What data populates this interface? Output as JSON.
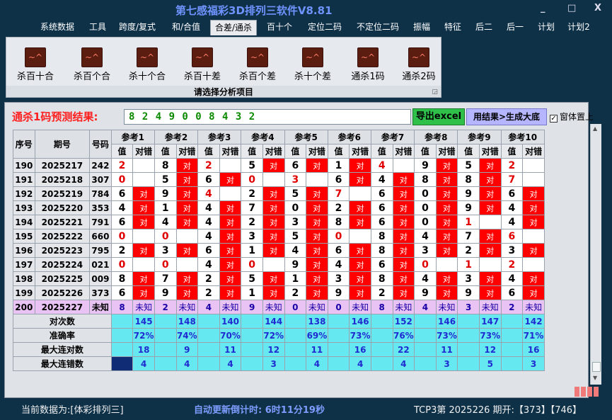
{
  "app": {
    "title": "第七感福彩3D排列三软件V8.81"
  },
  "window_controls": [
    "_",
    "□",
    "X"
  ],
  "menu": [
    "系统数据",
    "工具",
    "跨度/复式",
    "和/合值",
    "合差/通杀",
    "百十个",
    "定位二码",
    "不定位二码",
    "振幅",
    "特征",
    "后二",
    "后一",
    "计划",
    "计划2"
  ],
  "menu_active": 4,
  "ribbon": {
    "buttons": [
      "杀百十合",
      "杀百个合",
      "杀十个合",
      "杀百十差",
      "杀百个差",
      "杀十个差",
      "通杀1码",
      "通杀2码"
    ],
    "caption": "请选择分析项目"
  },
  "predict": {
    "label": "通杀1码预测结果:",
    "value": "8 2 4 9 0 0 8 4 3 2",
    "btn_excel": "导出excel",
    "btn_big": "用结果>生成大底",
    "checkbox_label": "窗体置上",
    "checkbox_checked": true
  },
  "table": {
    "head": {
      "no": "序号",
      "period": "期号",
      "code": "号码",
      "val": "值",
      "mark": "对错"
    },
    "groups": [
      "参考1",
      "参考2",
      "参考3",
      "参考4",
      "参考5",
      "参考6",
      "参考7",
      "参考8",
      "参考9",
      "参考10"
    ],
    "rows": [
      {
        "no": "190",
        "period": "2025217",
        "code": "242",
        "cells": [
          [
            "2",
            ""
          ],
          [
            "8",
            "对"
          ],
          [
            "2",
            ""
          ],
          [
            "5",
            "对"
          ],
          [
            "6",
            "对"
          ],
          [
            "1",
            "对"
          ],
          [
            "4",
            ""
          ],
          [
            "9",
            "对"
          ],
          [
            "5",
            "对"
          ],
          [
            "2",
            ""
          ]
        ]
      },
      {
        "no": "191",
        "period": "2025218",
        "code": "307",
        "cells": [
          [
            "0",
            ""
          ],
          [
            "5",
            "对"
          ],
          [
            "6",
            "对"
          ],
          [
            "0",
            ""
          ],
          [
            "3",
            ""
          ],
          [
            "6",
            "对"
          ],
          [
            "4",
            "对"
          ],
          [
            "8",
            "对"
          ],
          [
            "8",
            "对"
          ],
          [
            "7",
            ""
          ]
        ]
      },
      {
        "no": "192",
        "period": "2025219",
        "code": "784",
        "cells": [
          [
            "6",
            "对"
          ],
          [
            "9",
            "对"
          ],
          [
            "4",
            ""
          ],
          [
            "2",
            "对"
          ],
          [
            "5",
            "对"
          ],
          [
            "7",
            ""
          ],
          [
            "6",
            "对"
          ],
          [
            "0",
            "对"
          ],
          [
            "9",
            "对"
          ],
          [
            "6",
            "对"
          ]
        ]
      },
      {
        "no": "193",
        "period": "2025220",
        "code": "353",
        "cells": [
          [
            "4",
            "对"
          ],
          [
            "1",
            "对"
          ],
          [
            "4",
            "对"
          ],
          [
            "7",
            "对"
          ],
          [
            "0",
            "对"
          ],
          [
            "2",
            "对"
          ],
          [
            "6",
            "对"
          ],
          [
            "0",
            "对"
          ],
          [
            "9",
            "对"
          ],
          [
            "4",
            "对"
          ]
        ]
      },
      {
        "no": "194",
        "period": "2025221",
        "code": "791",
        "cells": [
          [
            "6",
            "对"
          ],
          [
            "4",
            "对"
          ],
          [
            "4",
            "对"
          ],
          [
            "2",
            "对"
          ],
          [
            "3",
            "对"
          ],
          [
            "8",
            "对"
          ],
          [
            "6",
            "对"
          ],
          [
            "0",
            "对"
          ],
          [
            "1",
            ""
          ],
          [
            "4",
            "对"
          ]
        ]
      },
      {
        "no": "195",
        "period": "2025222",
        "code": "660",
        "cells": [
          [
            "0",
            ""
          ],
          [
            "0",
            ""
          ],
          [
            "4",
            "对"
          ],
          [
            "3",
            "对"
          ],
          [
            "5",
            "对"
          ],
          [
            "0",
            ""
          ],
          [
            "8",
            "对"
          ],
          [
            "4",
            "对"
          ],
          [
            "7",
            "对"
          ],
          [
            "6",
            ""
          ]
        ]
      },
      {
        "no": "196",
        "period": "2025223",
        "code": "795",
        "cells": [
          [
            "2",
            "对"
          ],
          [
            "3",
            "对"
          ],
          [
            "6",
            "对"
          ],
          [
            "1",
            "对"
          ],
          [
            "4",
            "对"
          ],
          [
            "6",
            "对"
          ],
          [
            "8",
            "对"
          ],
          [
            "3",
            "对"
          ],
          [
            "2",
            "对"
          ],
          [
            "3",
            "对"
          ]
        ]
      },
      {
        "no": "197",
        "period": "2025224",
        "code": "021",
        "cells": [
          [
            "0",
            ""
          ],
          [
            "0",
            ""
          ],
          [
            "4",
            "对"
          ],
          [
            "0",
            ""
          ],
          [
            "9",
            "对"
          ],
          [
            "4",
            "对"
          ],
          [
            "6",
            "对"
          ],
          [
            "0",
            ""
          ],
          [
            "1",
            ""
          ],
          [
            "2",
            ""
          ]
        ]
      },
      {
        "no": "198",
        "period": "2025225",
        "code": "009",
        "cells": [
          [
            "8",
            "对"
          ],
          [
            "7",
            "对"
          ],
          [
            "2",
            "对"
          ],
          [
            "5",
            "对"
          ],
          [
            "1",
            "对"
          ],
          [
            "3",
            "对"
          ],
          [
            "8",
            "对"
          ],
          [
            "4",
            "对"
          ],
          [
            "3",
            "对"
          ],
          [
            "4",
            "对"
          ]
        ]
      },
      {
        "no": "199",
        "period": "2025226",
        "code": "373",
        "cells": [
          [
            "6",
            "对"
          ],
          [
            "9",
            "对"
          ],
          [
            "2",
            "对"
          ],
          [
            "1",
            "对"
          ],
          [
            "2",
            "对"
          ],
          [
            "9",
            "对"
          ],
          [
            "2",
            "对"
          ],
          [
            "9",
            "对"
          ],
          [
            "9",
            "对"
          ],
          [
            "6",
            "对"
          ]
        ]
      },
      {
        "no": "200",
        "period": "2025227",
        "code": "未知",
        "cells": [
          [
            "8",
            "未知"
          ],
          [
            "2",
            "未知"
          ],
          [
            "4",
            "未知"
          ],
          [
            "9",
            "未知"
          ],
          [
            "0",
            "未知"
          ],
          [
            "0",
            "未知"
          ],
          [
            "8",
            "未知"
          ],
          [
            "4",
            "未知"
          ],
          [
            "3",
            "未知"
          ],
          [
            "2",
            "未知"
          ]
        ]
      }
    ],
    "stats": [
      {
        "label": "对次数",
        "values": [
          "145",
          "148",
          "140",
          "144",
          "138",
          "146",
          "152",
          "146",
          "147",
          "142"
        ]
      },
      {
        "label": "准确率",
        "values": [
          "72%",
          "74%",
          "70%",
          "72%",
          "69%",
          "73%",
          "76%",
          "73%",
          "73%",
          "71%"
        ]
      },
      {
        "label": "最大连对数",
        "values": [
          "18",
          "9",
          "11",
          "12",
          "11",
          "16",
          "22",
          "11",
          "12",
          "16"
        ]
      },
      {
        "label": "最大连错数",
        "values": [
          "4",
          "4",
          "4",
          "3",
          "4",
          "4",
          "4",
          "3",
          "5",
          "3"
        ]
      }
    ]
  },
  "status": {
    "current": "当前数据为:[体彩排列三]",
    "countdown": "自动更新倒计时: 6时11分19秒",
    "tcp": "TCP3第 2025226 期开:【373】【746】"
  }
}
